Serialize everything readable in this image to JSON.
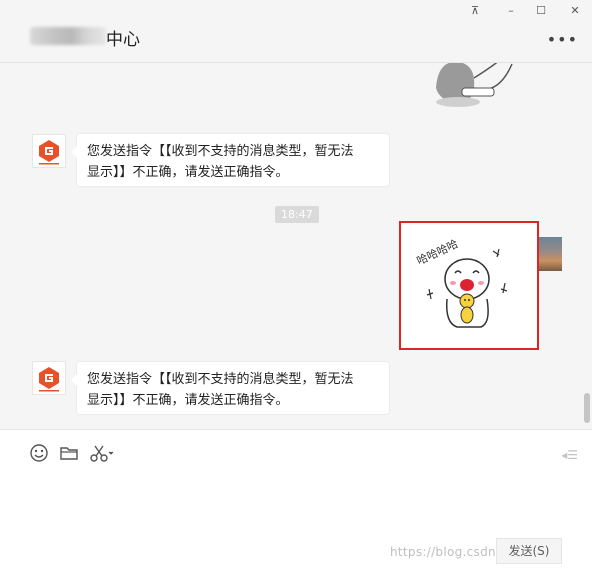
{
  "window": {
    "title": "中心",
    "controls": {
      "pin": "⊼",
      "minimize": "–",
      "maximize": "☐",
      "close": "✕"
    },
    "more_label": "•••"
  },
  "messages": [
    {
      "sender": "bot",
      "text_line1": "您发送指令【【收到不支持的消息类型，暂无法",
      "text_line2": "显示】】不正确，请发送正确指令。"
    },
    {
      "sender": "system",
      "time": "18:47"
    },
    {
      "sender": "me",
      "type": "sticker",
      "sticker_text": "哈哈哈哈"
    },
    {
      "sender": "bot",
      "text_line1": "您发送指令【【收到不支持的消息类型，暂无法",
      "text_line2": "显示】】不正确，请发送正确指令。"
    }
  ],
  "input": {
    "tools": [
      "emoji-icon",
      "folder-icon",
      "scissors-icon"
    ],
    "send_label": "发送(S)",
    "watermark": "https://blog.csdn.net/lady"
  },
  "colors": {
    "highlight": "#e02424",
    "brand_orange": "#e8502a"
  }
}
